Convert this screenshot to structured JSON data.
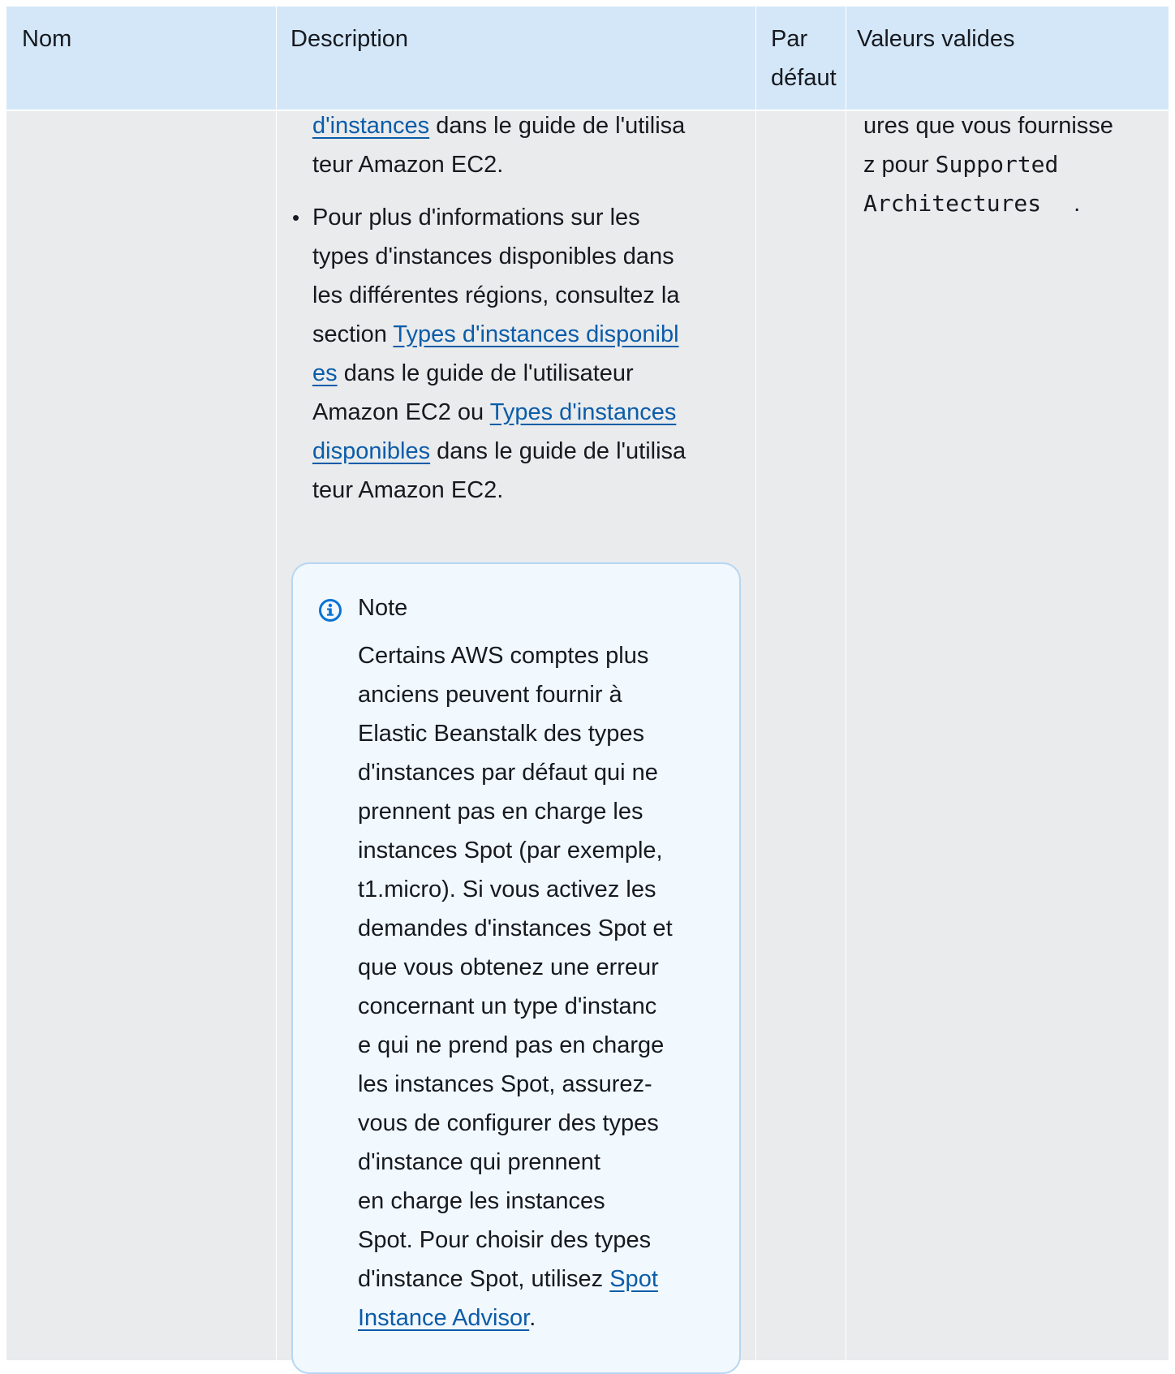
{
  "table": {
    "headers": [
      "Nom",
      "Description",
      "Par défaut",
      "Valeurs valides"
    ],
    "header_par": "Par",
    "header_defaut": "défaut"
  },
  "description": {
    "intro_link": "d'instances",
    "intro_rest": " dans le guide de l'utilisa",
    "intro_line2": "teur Amazon EC2.",
    "bullet": {
      "line1": "Pour plus d'informations sur les",
      "line2": "types d'instances disponibles dans",
      "line3": "les différentes régions, consultez la",
      "line4_pre": "section ",
      "line4_link": "Types d'instances disponibl",
      "line5_link": "es",
      "line5_rest": " dans le guide de l'utilisateur",
      "line6_pre": "Amazon EC2 ou ",
      "line6_link": "Types d'instances",
      "line7_link": "disponibles",
      "line7_rest": " dans le guide de l'utilisa",
      "line8": "teur Amazon EC2."
    }
  },
  "valid_values": {
    "line1": "ures que vous fournisse",
    "line2_pre": "z pour ",
    "line2_code": "Supported",
    "line3_code": "Architectures",
    "line3_tail": "."
  },
  "note": {
    "icon": "info-icon",
    "title": "Note",
    "lines": [
      "Certains AWS comptes plus",
      "anciens peuvent fournir à",
      "Elastic Beanstalk des types",
      "d'instances par défaut qui ne",
      "prennent pas en charge les",
      "instances Spot (par exemple,",
      "t1.micro). Si vous activez les",
      "demandes d'instances Spot et",
      "que vous obtenez une erreur",
      "concernant un type d'instanc",
      "e qui ne prend pas en charge",
      "les instances Spot, assurez-",
      "vous de configurer des types",
      "d'instance qui prennent",
      "en charge les instances"
    ],
    "last_line_pre": "Spot. Pour choisir des types",
    "link_line_pre": "d'instance Spot, utilisez ",
    "link_part1": "Spot",
    "link_part2": "Instance Advisor",
    "link_tail": "."
  },
  "colors": {
    "header_bg": "#d4e7f8",
    "body_bg": "#e9ebed",
    "link": "#0b5ca8",
    "note_bg": "#f1f8fe",
    "note_border": "#b6d6f2",
    "info_icon": "#0972d3"
  }
}
